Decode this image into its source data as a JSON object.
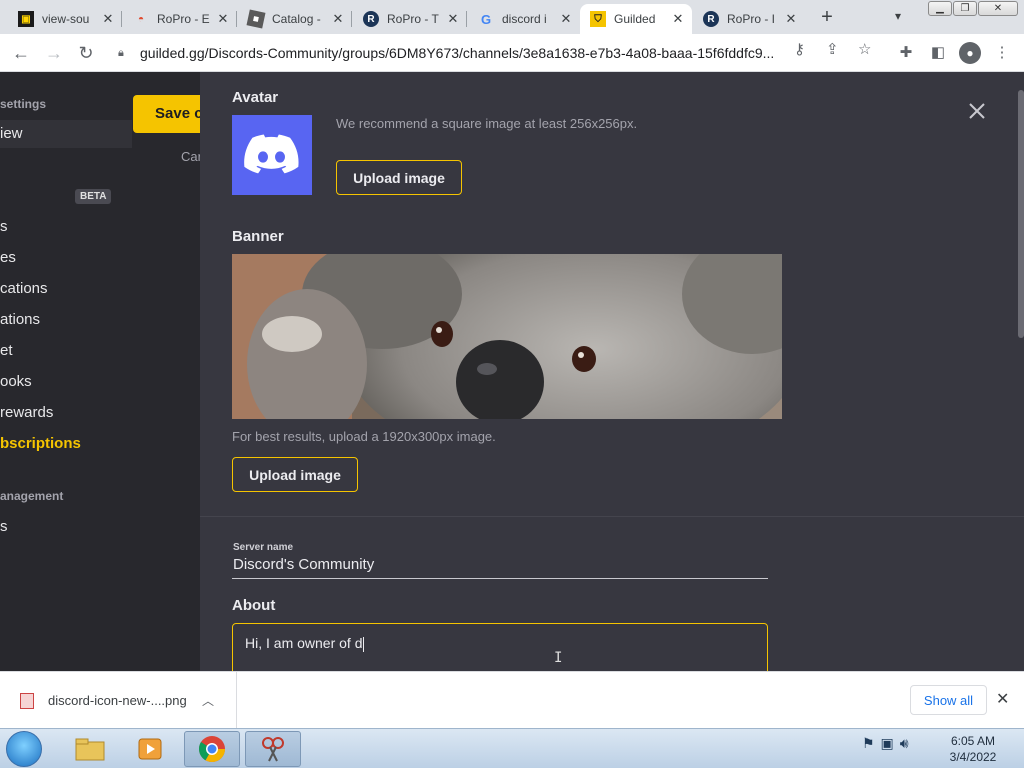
{
  "browser": {
    "tabs": [
      {
        "title": "view-sou",
        "favicon": "site-icon",
        "active": false
      },
      {
        "title": "RoPro - E",
        "favicon": "ropro-icon",
        "active": false
      },
      {
        "title": "Catalog -",
        "favicon": "catalog-icon",
        "active": false
      },
      {
        "title": "RoPro - T",
        "favicon": "ropro-icon",
        "active": false
      },
      {
        "title": "discord i",
        "favicon": "google-icon",
        "active": false
      },
      {
        "title": "Guilded",
        "favicon": "guilded-icon",
        "active": true
      },
      {
        "title": "RoPro - I",
        "favicon": "ropro-icon",
        "active": false
      }
    ],
    "new_tab": "+",
    "tab_close": "✕",
    "url": "guilded.gg/Discords-Community/groups/6DM8Y673/channels/3e8a1638-e7b3-4a08-baaa-15f6fddfc9..."
  },
  "sidebar": {
    "section_settings": "settings",
    "item_overview": "iew",
    "beta_badge": "BETA",
    "items": [
      "s",
      "es",
      "cations",
      "ations",
      "et",
      "ooks",
      "rewards"
    ],
    "item_subscriptions": "bscriptions",
    "section_management": "anagement",
    "item_last": "s",
    "save_button": "Save c",
    "cancel_link": "Car"
  },
  "modal": {
    "avatar_label": "Avatar",
    "avatar_hint": "We recommend a square image at least 256x256px.",
    "avatar_upload": "Upload image",
    "banner_label": "Banner",
    "banner_hint": "For best results, upload a 1920x300px image.",
    "banner_upload": "Upload image",
    "server_name_label": "Server name",
    "server_name_value": "Discord's Community",
    "about_label": "About",
    "about_value": "Hi, I am owner of d"
  },
  "downloads": {
    "file_name": "discord-icon-new-....png",
    "show_all": "Show all"
  },
  "taskbar": {
    "clock_time": "6:05 AM",
    "clock_date": "3/4/2022"
  },
  "colors": {
    "accent": "#f5c400",
    "sidebar_bg": "#28282d",
    "modal_bg": "#373740",
    "discord_blurple": "#5865f2"
  }
}
